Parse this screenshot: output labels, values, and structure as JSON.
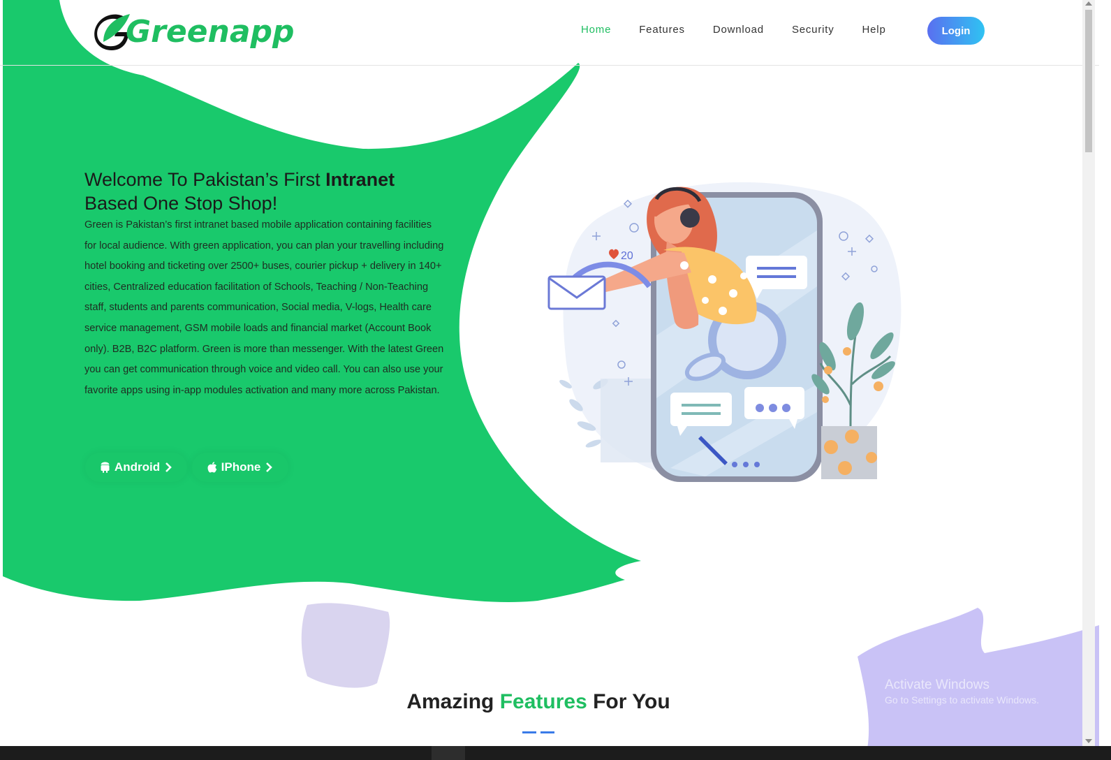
{
  "brand": {
    "name": "Greenapp",
    "color": "#1fbe61"
  },
  "nav": {
    "items": [
      {
        "label": "Home",
        "active": true
      },
      {
        "label": "Features",
        "active": false
      },
      {
        "label": "Download",
        "active": false
      },
      {
        "label": "Security",
        "active": false
      },
      {
        "label": "Help",
        "active": false
      }
    ],
    "login_label": "Login"
  },
  "hero": {
    "title_part1": "Welcome To Pakistan’s First ",
    "title_bold": "Intranet",
    "title_part2": "Based One Stop Shop!",
    "description": "Green is Pakistan’s first intranet based mobile application containing facilities for local audience. With green application, you can plan your travelling including hotel booking and ticketing over 2500+ buses, courier pickup + delivery in 140+ cities, Centralized education facilitation of Schools, Teaching / Non-Teaching staff, students and parents communication, Social media, V-logs, Health care service management, GSM mobile loads and financial market (Account Book only). B2B, B2C platform. Green is more than messenger. With the latest Green you can get communication through voice and video call. You can also use your favorite apps using in-app modules activation and many more across Pakistan.",
    "android_label": "Android",
    "iphone_label": "IPhone",
    "accent_green": "#19c76a",
    "illustration": {
      "likes": "20"
    }
  },
  "features": {
    "title_pre": "Amazing ",
    "title_highlight": "Features",
    "title_post": " For You"
  },
  "watermark": {
    "line1": "Activate Windows",
    "line2": "Go to Settings to activate Windows."
  }
}
